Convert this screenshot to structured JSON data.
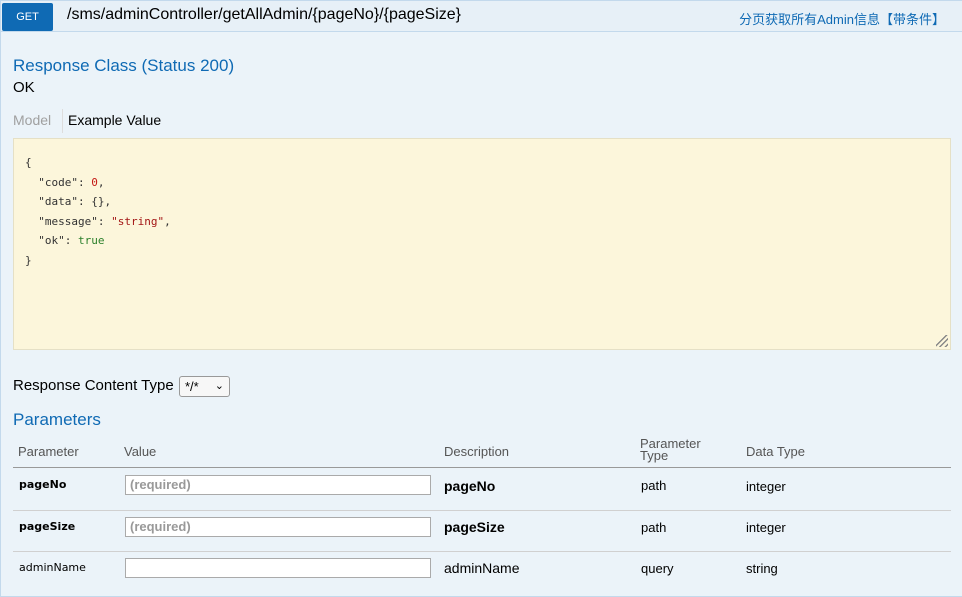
{
  "heading": {
    "method": "GET",
    "path": "/sms/adminController/getAllAdmin/{pageNo}/{pageSize}",
    "summary": "分页获取所有Admin信息【带条件】"
  },
  "response": {
    "title": "Response Class (Status 200)",
    "status_text": "OK",
    "tabs": [
      "Model",
      "Example Value"
    ],
    "example": {
      "open": "{",
      "lines": [
        {
          "key": "\"code\"",
          "value": "0",
          "kind": "num",
          "trail": ","
        },
        {
          "key": "\"data\"",
          "value": "{}",
          "kind": "k",
          "trail": ","
        },
        {
          "key": "\"message\"",
          "value": "\"string\"",
          "kind": "str",
          "trail": ","
        },
        {
          "key": "\"ok\"",
          "value": "true",
          "kind": "bool",
          "trail": ""
        }
      ],
      "close": "}"
    },
    "content_type_label": "Response Content Type",
    "content_type_value": "*/*"
  },
  "parameters": {
    "title": "Parameters",
    "headers": {
      "parameter": "Parameter",
      "value": "Value",
      "description": "Description",
      "param_type_1": "Parameter",
      "param_type_2": "Type",
      "data_type": "Data Type"
    },
    "rows": [
      {
        "name": "pageNo",
        "placeholder": "(required)",
        "description": "pageNo",
        "param_type": "path",
        "data_type": "integer",
        "required": true
      },
      {
        "name": "pageSize",
        "placeholder": "(required)",
        "description": "pageSize",
        "param_type": "path",
        "data_type": "integer",
        "required": true
      },
      {
        "name": "adminName",
        "placeholder": "",
        "description": "adminName",
        "param_type": "query",
        "data_type": "string",
        "required": false
      }
    ]
  },
  "colors": {
    "accent": "#0f6ab4",
    "panel_bg": "#ebf3f9",
    "code_bg": "#fcf6db"
  }
}
